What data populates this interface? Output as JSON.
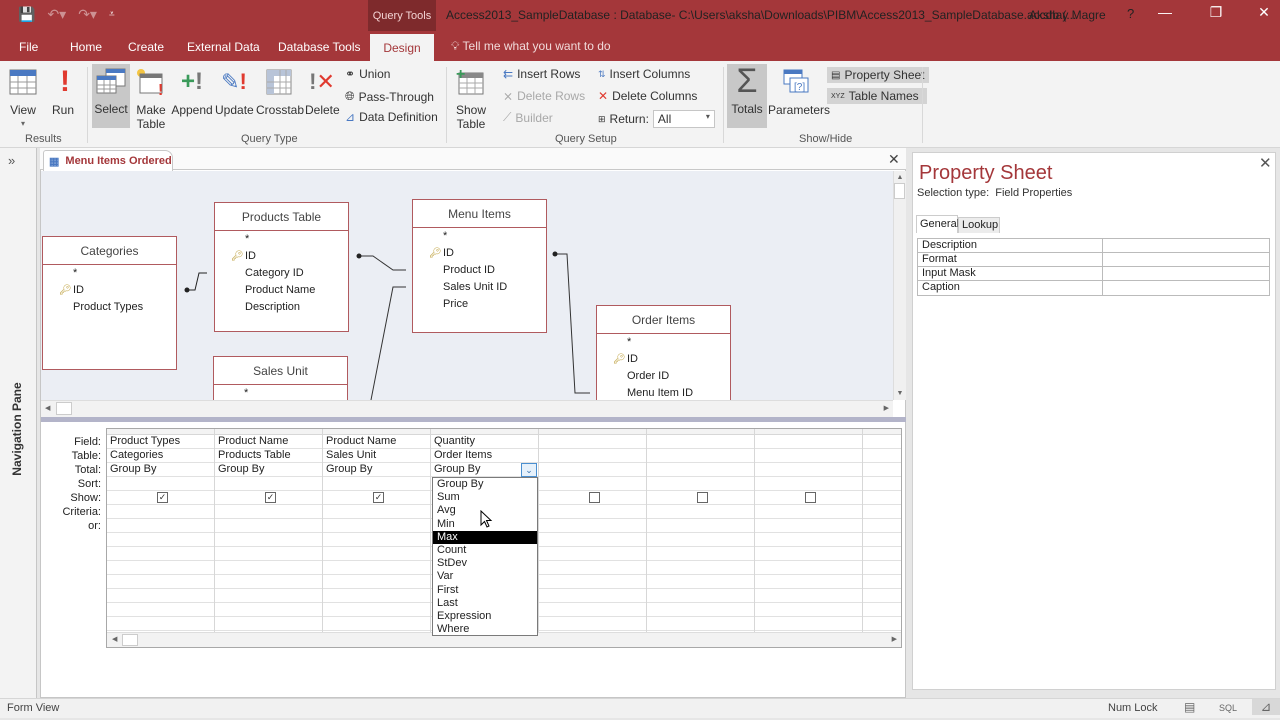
{
  "titlebar": {
    "context_label": "Query Tools",
    "title": "Access2013_SampleDatabase : Database- C:\\Users\\aksha\\Downloads\\PIBM\\Access2013_SampleDatabase.accdb (...",
    "user": "Akshay Magre",
    "help": "?",
    "minimize": "—",
    "restore": "❐",
    "close": "✕"
  },
  "tabs": {
    "file": "File",
    "home": "Home",
    "create": "Create",
    "external_data": "External Data",
    "database_tools": "Database Tools",
    "design": "Design",
    "tell_me": "Tell me what you want to do"
  },
  "ribbon": {
    "results": {
      "label": "Results",
      "view": "View",
      "run": "Run"
    },
    "query_type": {
      "label": "Query Type",
      "select": "Select",
      "make_table_1": "Make",
      "make_table_2": "Table",
      "append": "Append",
      "update": "Update",
      "crosstab": "Crosstab",
      "delete": "Delete",
      "union": "Union",
      "pass_through": "Pass-Through",
      "data_definition": "Data Definition"
    },
    "query_setup": {
      "label": "Query Setup",
      "show_table_1": "Show",
      "show_table_2": "Table",
      "insert_rows": "Insert Rows",
      "delete_rows": "Delete Rows",
      "builder": "Builder",
      "insert_columns": "Insert Columns",
      "delete_columns": "Delete Columns",
      "return_label": "Return:",
      "return_value": "All"
    },
    "show_hide": {
      "label": "Show/Hide",
      "totals": "Totals",
      "parameters": "Parameters",
      "property_sheet": "Property Sheet",
      "table_names": "Table Names"
    }
  },
  "nav_pane": {
    "label": "Navigation Pane",
    "expand": "»"
  },
  "document": {
    "tab_label": "Menu Items Ordered",
    "close": "✕"
  },
  "diagram": {
    "tables": [
      {
        "name": "Categories",
        "fields": [
          "*",
          "ID",
          "Product Types"
        ],
        "key_index": 1
      },
      {
        "name": "Products Table",
        "fields": [
          "*",
          "ID",
          "Category ID",
          "Product Name",
          "Description"
        ],
        "key_index": 1
      },
      {
        "name": "Menu Items",
        "fields": [
          "*",
          "ID",
          "Product ID",
          "Sales Unit ID",
          "Price"
        ],
        "key_index": 1
      },
      {
        "name": "Order Items",
        "fields": [
          "*",
          "ID",
          "Order ID",
          "Menu Item ID"
        ],
        "key_index": 1
      },
      {
        "name": "Sales Unit",
        "fields": [
          "*"
        ],
        "key_index": -1
      }
    ]
  },
  "grid": {
    "row_labels": [
      "Field:",
      "Table:",
      "Total:",
      "Sort:",
      "Show:",
      "Criteria:",
      "or:"
    ],
    "columns": [
      {
        "field": "Product Types",
        "table": "Categories",
        "total": "Group By",
        "sort": "",
        "show": true
      },
      {
        "field": "Product Name",
        "table": "Products Table",
        "total": "Group By",
        "sort": "",
        "show": true
      },
      {
        "field": "Product Name",
        "table": "Sales Unit",
        "total": "Group By",
        "sort": "",
        "show": true
      },
      {
        "field": "Quantity",
        "table": "Order Items",
        "total": "Group By",
        "sort": "",
        "show": null
      },
      {
        "field": "",
        "table": "",
        "total": "",
        "sort": "",
        "show": false
      },
      {
        "field": "",
        "table": "",
        "total": "",
        "sort": "",
        "show": false
      },
      {
        "field": "",
        "table": "",
        "total": "",
        "sort": "",
        "show": false
      },
      {
        "field": "",
        "table": "",
        "total": "",
        "sort": "",
        "show": null
      }
    ],
    "total_dropdown": {
      "options": [
        "Group By",
        "Sum",
        "Avg",
        "Min",
        "Max",
        "Count",
        "StDev",
        "Var",
        "First",
        "Last",
        "Expression",
        "Where"
      ],
      "highlighted": "Max"
    }
  },
  "property_sheet": {
    "title": "Property Sheet",
    "selection_type": "Selection type:  Field Properties",
    "tab_general": "General",
    "tab_lookup": "Lookup",
    "properties": [
      {
        "name": "Description",
        "value": ""
      },
      {
        "name": "Format",
        "value": ""
      },
      {
        "name": "Input Mask",
        "value": ""
      },
      {
        "name": "Caption",
        "value": ""
      }
    ],
    "close": "✕"
  },
  "status_bar": {
    "left": "Form View",
    "num_lock": "Num Lock",
    "sql": "SQL"
  },
  "colors": {
    "accent": "#a4373a",
    "context_tab": "#7e2a2c",
    "diagram_bg": "#ebeef4"
  }
}
